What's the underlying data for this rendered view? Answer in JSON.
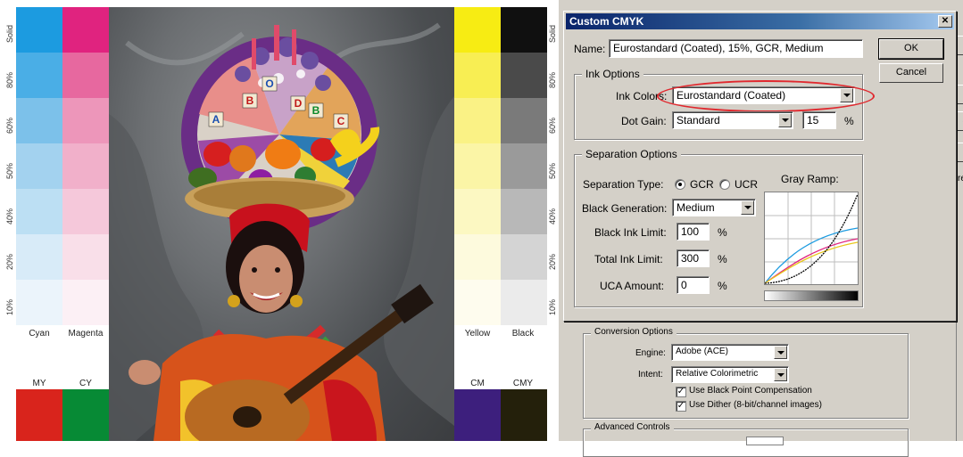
{
  "test_image": {
    "cyan_label": "Cyan",
    "magenta_label": "Magenta",
    "yellow_label": "Yellow",
    "black_label": "Black",
    "my_label": "MY",
    "cy_label": "CY",
    "cm_label": "CM",
    "cmy_label": "CMY",
    "percent_left": [
      "Solid",
      "80%",
      "60%",
      "50%",
      "40%",
      "20%",
      "10%"
    ],
    "percent_right": [
      "Solid",
      "80%",
      "60%",
      "50%",
      "40%",
      "20%",
      "10%"
    ],
    "blocks": [
      "A",
      "B",
      "O",
      "D",
      "B",
      "C"
    ]
  },
  "colors": {
    "cyan": [
      "#1c9be0",
      "#4aaee6",
      "#7cc1ea",
      "#a3d2ef",
      "#bcdff3",
      "#d8ebf8",
      "#ebf4fb"
    ],
    "magenta": [
      "#e0237f",
      "#e7689f",
      "#ed96ba",
      "#f1b0ca",
      "#f5c8da",
      "#f9dfe9",
      "#fcf0f5"
    ],
    "yellow": [
      "#f7ec13",
      "#f8ee53",
      "#faf285",
      "#fbf5a6",
      "#fcf8c2",
      "#fdfadd",
      "#fefcee"
    ],
    "black": [
      "#101010",
      "#4a4a4a",
      "#7a7a7a",
      "#9a9a9a",
      "#b8b8b8",
      "#d4d4d4",
      "#ebebeb"
    ],
    "my": "#d9241c",
    "cy": "#078a35",
    "cm": "#3d1f7d",
    "cmy": "#24200b",
    "annotation": "#e0282e"
  },
  "dialog": {
    "title": "Custom CMYK",
    "close_glyph": "✕",
    "name_label": "Name:",
    "name_value": "Eurostandard (Coated), 15%, GCR, Medium",
    "ok_label": "OK",
    "cancel_label": "Cancel",
    "ink_options": {
      "title": "Ink Options",
      "ink_colors_label": "Ink Colors:",
      "ink_colors_value": "Eurostandard (Coated)",
      "dot_gain_label": "Dot Gain:",
      "dot_gain_value": "Standard",
      "dot_gain_pct": "15",
      "pct_unit": "%"
    },
    "separation_options": {
      "title": "Separation Options",
      "type_label": "Separation Type:",
      "gcr_label": "GCR",
      "ucr_label": "UCR",
      "gray_ramp_label": "Gray Ramp:",
      "black_gen_label": "Black Generation:",
      "black_gen_value": "Medium",
      "black_ink_limit_label": "Black Ink Limit:",
      "black_ink_limit_value": "100",
      "total_ink_limit_label": "Total Ink Limit:",
      "total_ink_limit_value": "300",
      "uca_label": "UCA Amount:",
      "uca_value": "0",
      "pct_unit": "%"
    }
  },
  "behind": {
    "conversion_title": "Conversion Options",
    "engine_label": "Engine:",
    "engine_value": "Adobe (ACE)",
    "intent_label": "Intent:",
    "intent_value": "Relative Colorimetric",
    "bpc_label": "Use Black Point Compensation",
    "dither_label": "Use Dither (8-bit/channel images)",
    "advanced_title": "Advanced Controls",
    "partial_labels": [
      "L",
      "S",
      "v",
      "re"
    ],
    "check_glyph": "✓"
  }
}
